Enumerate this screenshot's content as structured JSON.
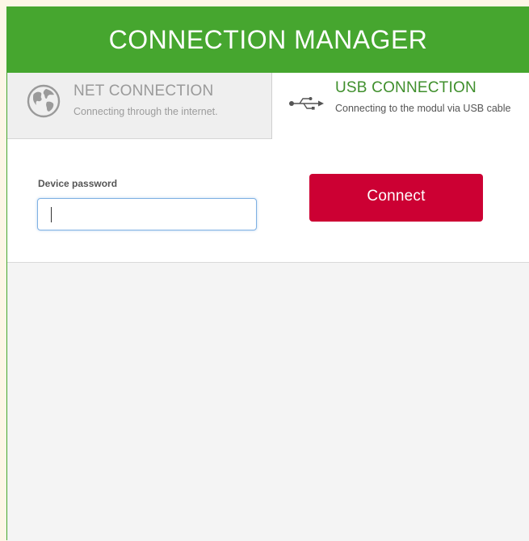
{
  "header": {
    "title": "CONNECTION MANAGER"
  },
  "tabs": [
    {
      "id": "net",
      "icon": "globe-icon",
      "title": "NET CONNECTION",
      "subtitle": "Connecting through the internet.",
      "active": false
    },
    {
      "id": "usb",
      "icon": "usb-icon",
      "title": "USB CONNECTION",
      "subtitle": "Connecting to the modul via USB cable",
      "active": true
    }
  ],
  "form": {
    "password_label": "Device password",
    "password_value": "",
    "connect_label": "Connect"
  },
  "colors": {
    "header_green": "#46a62f",
    "active_tab_text": "#3f8f2c",
    "connect_button": "#cc0033",
    "input_focus_border": "#7fb1e3"
  }
}
